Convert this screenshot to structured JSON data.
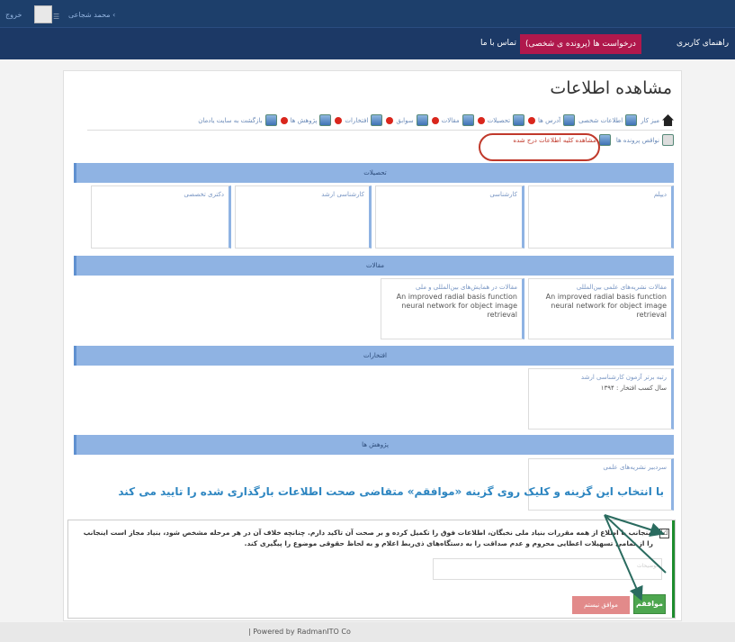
{
  "topbar": {
    "logout": "خروج",
    "user": "محمد شجاعی ‹"
  },
  "navbar": {
    "items": [
      {
        "label": "راهنمای کاربری",
        "active": false
      },
      {
        "label": "درخواست ها (پرونده ی شخصی)",
        "active": true
      },
      {
        "label": "تماس با ما",
        "active": false
      }
    ]
  },
  "page": {
    "title": "مشاهده اطلاعات"
  },
  "tabs": [
    {
      "label": "میز کار",
      "icon": "home-icon"
    },
    {
      "label": "اطلاعات شخصی",
      "icon": "person-icon"
    },
    {
      "label": "آدرس ها",
      "icon": "address-icon"
    },
    {
      "label": "تحصیلات",
      "icon": "education-icon"
    },
    {
      "label": "مقالات",
      "icon": "article-icon"
    },
    {
      "label": "سوابق",
      "icon": "history-icon"
    },
    {
      "label": "افتخارات",
      "icon": "medal-icon"
    },
    {
      "label": "پژوهش ها",
      "icon": "research-icon"
    },
    {
      "label": "بازگشت به سایت یادمان",
      "icon": "return-icon"
    }
  ],
  "tabs2": [
    {
      "label": "نواقص پرونده ها"
    },
    {
      "label": "مشاهده کلیه اطلاعات درج شده"
    }
  ],
  "sections": {
    "education": {
      "title": "تحصیلات",
      "cards": [
        "دیپلم",
        "کارشناسی",
        "کارشناسی ارشد",
        "دکتری تخصصی"
      ]
    },
    "articles": {
      "title": "مقالات",
      "cards": [
        {
          "title": "مقالات نشریه‌های علمی بین‌المللی",
          "text": "An improved radial basis function neural network for object image retrieval"
        },
        {
          "title": "مقالات در همایش‌های بین‌المللی و ملی",
          "text": "An improved radial basis function neural network for object image retrieval"
        }
      ]
    },
    "honors": {
      "title": "افتخارات",
      "card": {
        "title": "رتبه برتر آزمون کارشناسی ارشد",
        "sub": "سال کسب افتخار : ۱۳۹۴"
      }
    },
    "research": {
      "title": "پژوهش ها",
      "card": {
        "title": "سردبیر نشریه‌های علمی"
      }
    }
  },
  "annotation": "با انتخاب این گزینه و کلیک روی گزینه «موافقم» متقاضی صحت اطلاعات بارگذاری شده را تایید می کند",
  "consent": {
    "text": "اینجانب با اطلاع از همه مقررات بنیاد ملی نخبگان، اطلاعات فوق را تکمیل کرده و بر صحت آن تاکید دارم. چنانچه خلاف آن در هر مرحله مشخص شود، بنیاد مجاز است اینجانب را از تمامی تسهیلات اعطایی محروم و عدم صداقت را به دستگاه‌های ذی‌ربط اعلام و به لحاظ حقوقی موضوع را پیگیری کند.",
    "checkbox_mark": "☑",
    "remarks_placeholder": "توضیحات",
    "agree_label": "موافقم",
    "disagree_label": "موافق نیستم"
  },
  "footer": {
    "text": "|   Powered by RadmanITO Co"
  },
  "colors": {
    "topbar": "#1d3f6b",
    "active_nav": "#b0184c",
    "section_bar": "#8fb3e3",
    "annotation": "#2e86c1",
    "agree": "#4da64f",
    "disagree": "#e28a8a"
  }
}
